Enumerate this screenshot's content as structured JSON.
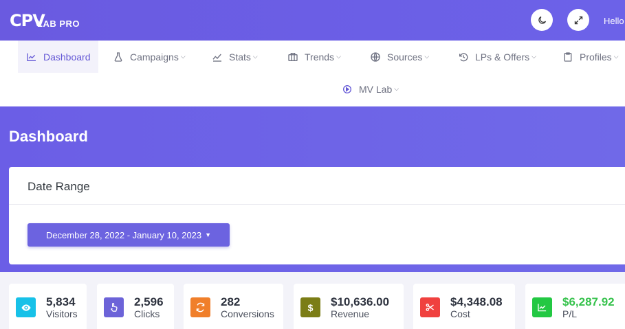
{
  "header": {
    "logo_brand": "CPV",
    "logo_sub": "LAB PRO",
    "greeting": "Hello"
  },
  "nav": {
    "items": [
      {
        "label": "Dashboard",
        "icon": "line-chart-icon"
      },
      {
        "label": "Campaigns",
        "icon": "flask-icon"
      },
      {
        "label": "Stats",
        "icon": "trend-icon"
      },
      {
        "label": "Trends",
        "icon": "columns-icon"
      },
      {
        "label": "Sources",
        "icon": "globe-icon"
      },
      {
        "label": "LPs & Offers",
        "icon": "history-icon"
      },
      {
        "label": "Profiles",
        "icon": "clipboard-icon"
      },
      {
        "label": "MV Lab",
        "icon": "play-circle-icon"
      }
    ]
  },
  "page": {
    "title": "Dashboard"
  },
  "date_range": {
    "title": "Date Range",
    "value": "December 28, 2022 - January 10, 2023"
  },
  "stats": [
    {
      "value": "5,834",
      "label": "Visitors",
      "color": "#17c1e8",
      "icon": "eye-icon"
    },
    {
      "value": "2,596",
      "label": "Clicks",
      "color": "#6c63d8",
      "icon": "pointer-icon"
    },
    {
      "value": "282",
      "label": "Conversions",
      "color": "#f07f2a",
      "icon": "refresh-icon"
    },
    {
      "value": "$10,636.00",
      "label": "Revenue",
      "color": "#7b7d16",
      "icon": "dollar-icon"
    },
    {
      "value": "$4,348.08",
      "label": "Cost",
      "color": "#f0413f",
      "icon": "scissors-icon"
    },
    {
      "value": "$6,287.92",
      "label": "P/L",
      "color": "#23c843",
      "icon": "chart-up-icon",
      "value_color": "#36c24c"
    }
  ]
}
